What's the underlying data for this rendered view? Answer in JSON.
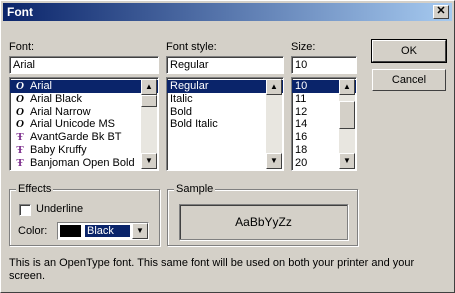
{
  "window": {
    "title": "Font",
    "close_icon": "close-icon"
  },
  "font": {
    "label": "Font:",
    "value": "Arial",
    "items": [
      {
        "name": "Arial",
        "icon": "O",
        "selected": true
      },
      {
        "name": "Arial Black",
        "icon": "O"
      },
      {
        "name": "Arial Narrow",
        "icon": "O"
      },
      {
        "name": "Arial Unicode MS",
        "icon": "O"
      },
      {
        "name": "AvantGarde Bk BT",
        "icon": "TT"
      },
      {
        "name": "Baby Kruffy",
        "icon": "TT"
      },
      {
        "name": "Banjoman Open Bold",
        "icon": "TT"
      }
    ]
  },
  "style": {
    "label": "Font style:",
    "value": "Regular",
    "items": [
      "Regular",
      "Italic",
      "Bold",
      "Bold Italic"
    ]
  },
  "size": {
    "label": "Size:",
    "value": "10",
    "items": [
      "10",
      "11",
      "12",
      "14",
      "16",
      "18",
      "20"
    ]
  },
  "buttons": {
    "ok": "OK",
    "cancel": "Cancel"
  },
  "effects": {
    "label": "Effects",
    "underline": "Underline",
    "color_label": "Color:",
    "color_value": "Black"
  },
  "sample": {
    "label": "Sample",
    "text": "AaBbYyZz"
  },
  "description": "This is an OpenType font. This same font will be used on both your printer and your screen."
}
